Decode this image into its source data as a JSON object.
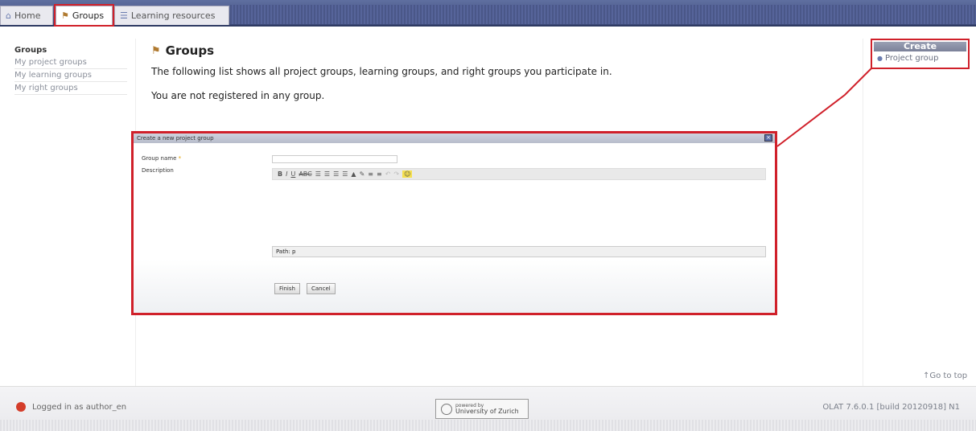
{
  "tabs": [
    {
      "label": "Home",
      "icon": "home-icon"
    },
    {
      "label": "Groups",
      "icon": "groups-icon",
      "active": true
    },
    {
      "label": "Learning resources",
      "icon": "learning-resources-icon"
    }
  ],
  "leftnav": {
    "items": [
      {
        "label": "Groups",
        "active": true
      },
      {
        "label": "My project groups"
      },
      {
        "label": "My learning groups"
      },
      {
        "label": "My right groups"
      }
    ]
  },
  "main": {
    "title": "Groups",
    "description": "The following list shows all project groups, learning groups, and right groups you participate in.",
    "empty_message": "You are not registered in any group."
  },
  "create_box": {
    "header": "Create",
    "link": "Project group"
  },
  "modal": {
    "title": "Create a new project group",
    "close_label": "×",
    "name_label": "Group name",
    "required_mark": "*",
    "description_label": "Description",
    "toolbar": {
      "bold": "B",
      "italic": "I",
      "underline": "U",
      "strike": "ABC"
    },
    "path_text": "Path: p",
    "finish_label": "Finish",
    "cancel_label": "Cancel"
  },
  "go_top": "Go to top",
  "footer": {
    "logged_in": "Logged in as author_en",
    "powered_by": "powered by",
    "university": "University of Zurich",
    "version": "OLAT 7.6.0.1 [build 20120918] N1"
  },
  "colors": {
    "highlight": "#d0202a",
    "topbar": "#3d4a78"
  }
}
